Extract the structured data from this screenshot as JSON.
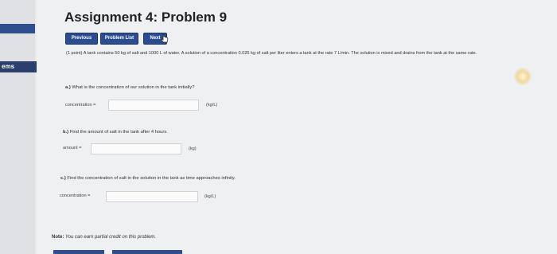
{
  "sidebar": {
    "items": [
      {
        "label": ""
      },
      {
        "label": "ems"
      }
    ]
  },
  "page": {
    "title": "Assignment 4: Problem 9"
  },
  "nav": {
    "previous": "Previous",
    "problem_list": "Problem List",
    "next": "Next"
  },
  "problem": {
    "statement": "(1 point) A tank contains 50 kg of salt and 1000 L of water. A solution of a concentration 0.025 kg of salt per liter enters a tank at the rate 7 L/min. The solution is mixed and drains from the tank at the same rate."
  },
  "questions": [
    {
      "letter": "a.)",
      "text": "What is the concentration of our solution in the tank initially?",
      "field_label": "concentration =",
      "value": "",
      "unit": "(kg/L)"
    },
    {
      "letter": "b.)",
      "text": "Find the amount of salt in the tank after 4 hours.",
      "field_label": "amount =",
      "value": "",
      "unit": "(kg)"
    },
    {
      "letter": "c.)",
      "text": "Find the concentration of salt in the solution in the tank as time approaches infinity.",
      "field_label": "concentration =",
      "value": "",
      "unit": "(kg/L)"
    }
  ],
  "note": {
    "label": "Note:",
    "text": "You can earn partial credit on this problem."
  },
  "colors": {
    "button": "#2b4c8f",
    "nav_accent": "#2f4e8e",
    "background": "#eef0f2"
  }
}
